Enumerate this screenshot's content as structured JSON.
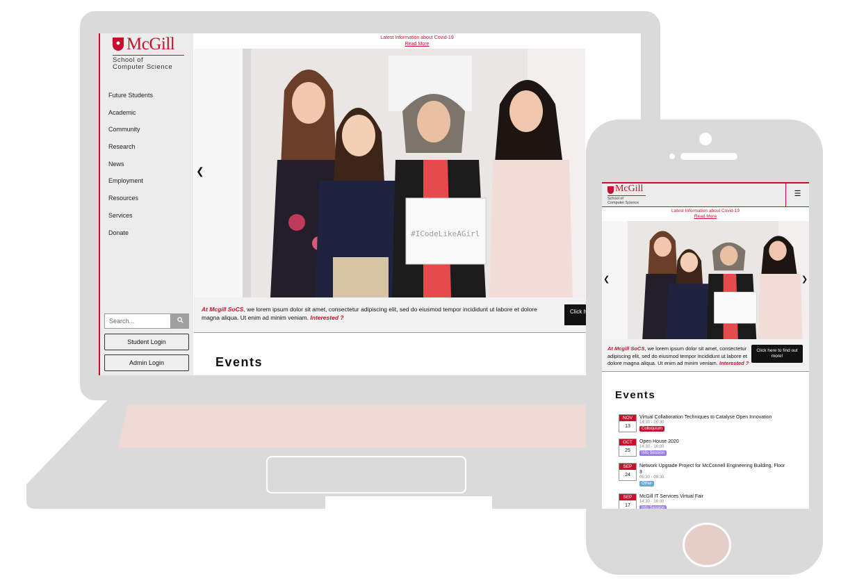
{
  "colors": {
    "mcgill_red": "#c8102e",
    "device_gray": "#dadada",
    "tag_colloquium": "#c8102e",
    "tag_info": "#9b7fe6",
    "tag_other": "#6aa8d8"
  },
  "site": {
    "logo_text": "McGill",
    "logo_subtitle_1": "School of",
    "logo_subtitle_2": "Computer Science",
    "covid_notice": "Latest Information about Covid-19",
    "read_more": "Read More",
    "nav_items": [
      "Future Students",
      "Academic",
      "Community",
      "Research",
      "News",
      "Employment",
      "Resources",
      "Services",
      "Donate"
    ],
    "search_placeholder": "Search...",
    "search_icon": "search-icon",
    "student_login": "Student Login",
    "admin_login": "Admin Login",
    "blurb_lead": "At Mcgill SoCS",
    "blurb_body": ", we lorem ipsum dolor sit amet, consectetur adipiscing elit, sed do eiusmod tempor incididunt ut labore et dolore magna aliqua. Ut enim ad minim veniam.",
    "blurb_link": "Interested ?",
    "cta_desktop": "Click h",
    "cta_mobile": "Click here to find out more!",
    "events_heading": "Events",
    "hero_sign": "#ICodeLikeAGirl",
    "menu_icon": "hamburger-icon"
  },
  "events": [
    {
      "month": "NOV",
      "day": "13",
      "title": "Virtual Collaboration Techniques to Catalyse Open Innovation",
      "time": "14:30 - 16:30",
      "tag": "Colloquium",
      "tag_color": "#c8102e"
    },
    {
      "month": "OCT",
      "day": "25",
      "title": "Open House 2020",
      "time": "14:30 - 16:00",
      "tag": "Info Session",
      "tag_color": "#9b7fe6"
    },
    {
      "month": "SEP",
      "day": "24",
      "title": "Network Upgrade Project for McConnell Engineering Building, Floor 3",
      "time": "06:30 - 09:30",
      "tag": "Other",
      "tag_color": "#6aa8d8"
    },
    {
      "month": "SEP",
      "day": "17",
      "title": "McGill IT Services Virtual Fair",
      "time": "14:30 - 16:00",
      "tag": "Info Session",
      "tag_color": "#9b7fe6"
    }
  ]
}
